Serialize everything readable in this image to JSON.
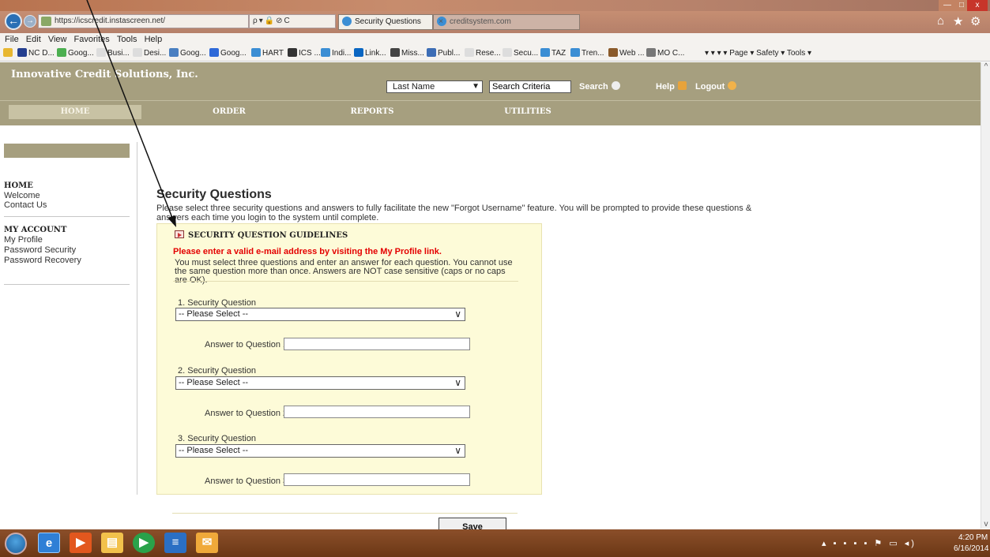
{
  "window": {
    "minimize_icon": "minimize-icon",
    "maximize_icon": "maximize-icon",
    "close_label": "x"
  },
  "browser": {
    "url": "https://icscredit.instascreen.net/",
    "address_tools": "ρ▾🔒⊘C",
    "tabs": [
      {
        "label": "Security Questions",
        "active": true
      },
      {
        "label": "creditsystem.com",
        "active": false
      }
    ],
    "tab_close": "×",
    "menu": [
      "File",
      "Edit",
      "View",
      "Favorites",
      "Tools",
      "Help"
    ],
    "favorites": [
      "NC D...",
      "Goog...",
      "Busi...",
      "Desi...",
      "Goog...",
      "Goog...",
      "HART",
      "ICS ...",
      "Indi...",
      "Link...",
      "Miss...",
      "Publ...",
      "Rese...",
      "Secu...",
      "TAZ",
      "Tren...",
      "Web ...",
      "MO C..."
    ],
    "command_bar": "▾  ▾  ▾  ▾ Page ▾  Safety ▾  Tools ▾",
    "colors": {
      "chrome": "#c68e72",
      "taskbar": "#7a4320"
    }
  },
  "app": {
    "brand": "Innovative Credit Solutions, Inc.",
    "search": {
      "select_value": "Last Name",
      "input_value": "Search Criteria",
      "search_label": "Search",
      "help_label": "Help",
      "logout_label": "Logout"
    },
    "nav": [
      "HOME",
      "ORDER",
      "REPORTS",
      "UTILITIES"
    ],
    "colors": {
      "header": "#a69f7f",
      "panel": "#fdfbd8",
      "warning": "#e40000"
    }
  },
  "sidebar": {
    "home": {
      "heading": "HOME",
      "items": [
        "Welcome",
        "Contact Us"
      ]
    },
    "account": {
      "heading": "MY ACCOUNT",
      "items": [
        "My Profile",
        "Password Security",
        "Password Recovery"
      ]
    }
  },
  "main": {
    "title": "Security Questions",
    "description": "Please select three security questions and answers to fully facilitate the new \"Forgot Username\" feature. You will be prompted to provide these questions & answers each time you login to the system until complete.",
    "guidelines_title": "SECURITY QUESTION GUIDELINES",
    "email_warning": "Please enter a valid e-mail address by visiting the My Profile link.",
    "guidelines_text": "You must select three questions and enter an answer for each question. You cannot use the same question more than once. Answers are NOT case sensitive (caps or no caps are OK).",
    "questions": [
      {
        "label": "1. Security Question",
        "select_value": "-- Please Select --",
        "answer_label": "Answer to Question 1:",
        "answer_value": ""
      },
      {
        "label": "2. Security Question",
        "select_value": "-- Please Select --",
        "answer_label": "Answer to Question 2:",
        "answer_value": ""
      },
      {
        "label": "3. Security Question",
        "select_value": "-- Please Select --",
        "answer_label": "Answer to Question 3:",
        "answer_value": ""
      }
    ],
    "save_label": "Save"
  },
  "taskbar": {
    "tray_icons": "▴ ▪ ▪ ▪ ▪ ⚑ ▭ ◂)",
    "time": "4:20 PM",
    "date": "6/16/2014"
  }
}
